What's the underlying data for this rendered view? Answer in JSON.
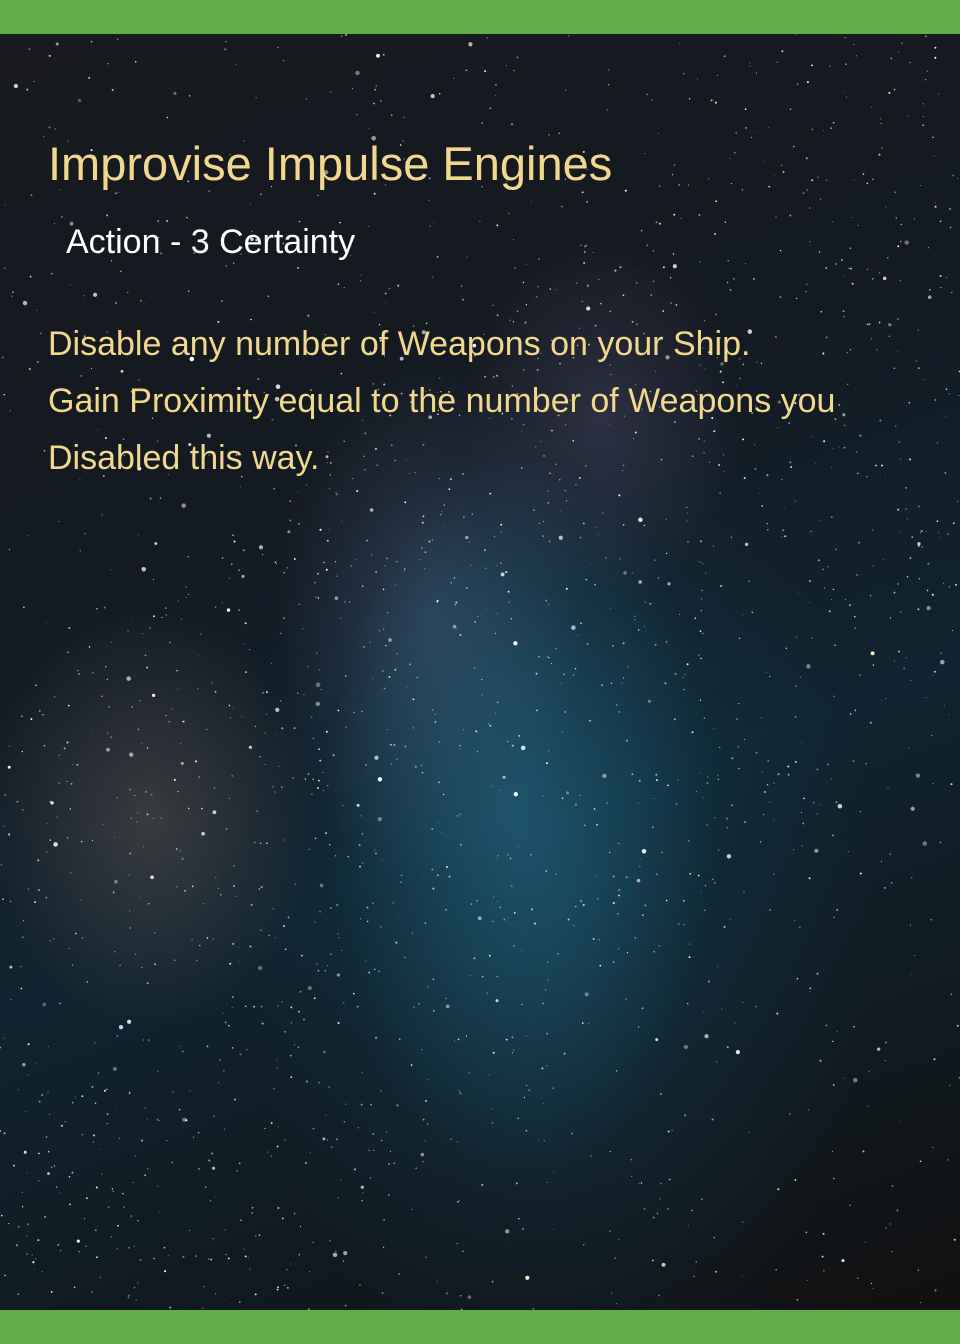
{
  "card": {
    "title": "Improvise Impulse Engines",
    "type_line": "Action - 3 Certainty",
    "rules_text": [
      "Disable any number of Weapons on your Ship.",
      "Gain Proximity equal to the number of Weapons you Disabled this way."
    ]
  },
  "colors": {
    "band": "#62ad47",
    "title_text": "#f2d88d",
    "type_line_text": "#ffffff",
    "rules_text": "#f2d88d"
  },
  "background": "milky-way-starfield"
}
